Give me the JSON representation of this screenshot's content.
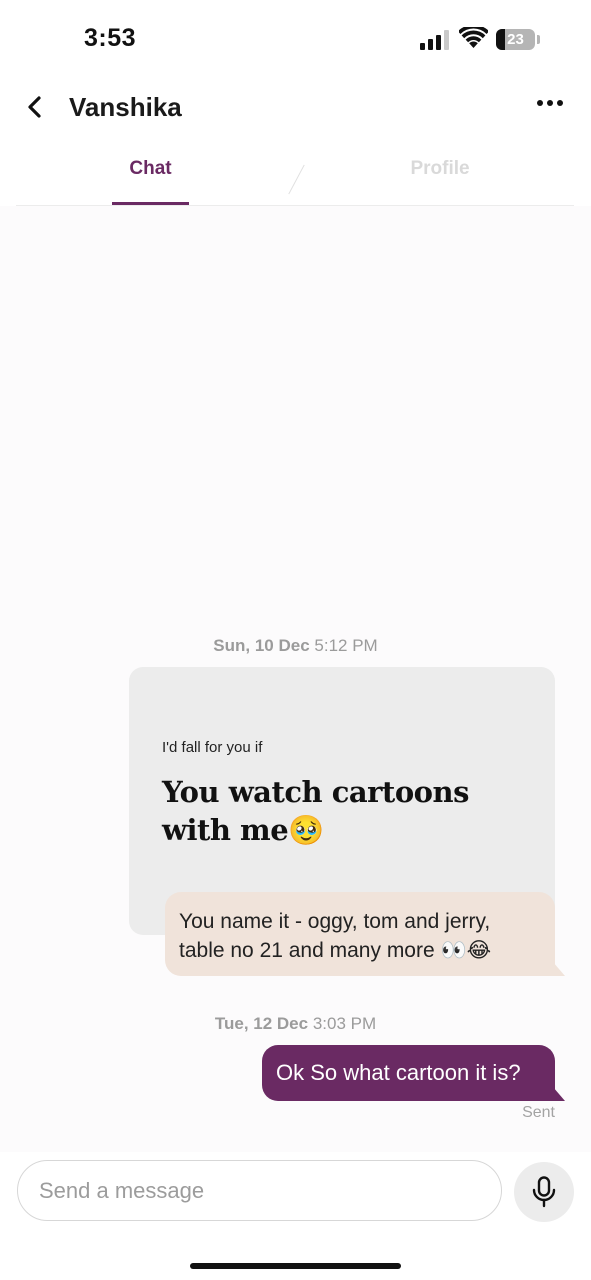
{
  "status_bar": {
    "time": "3:53",
    "battery": "23",
    "icons": [
      "signal-icon",
      "wifi-icon",
      "battery-icon"
    ]
  },
  "header": {
    "contact_name": "Vanshika",
    "tabs": [
      {
        "label": "Chat",
        "active": true
      },
      {
        "label": "Profile",
        "active": false
      }
    ],
    "icons": [
      "back-arrow-icon",
      "more-options-icon"
    ],
    "accent_color": "#6a2a63"
  },
  "messages": {
    "first_timestamp": {
      "day": "Sun, 10 Dec",
      "time": "5:12 PM"
    },
    "prompt_card": {
      "question": "I'd fall for you if",
      "answer": "You watch cartoons with me🥹"
    },
    "reply": {
      "text": "You name it - oggy, tom and jerry, table no 21 and many more 👀😂",
      "bubble_color": "#f0e3da"
    },
    "second_timestamp": {
      "day": "Tue, 12 Dec",
      "time": "3:03 PM"
    },
    "sent_message": {
      "text": "Ok So what cartoon it is?",
      "status": "Sent",
      "bubble_color": "#6a2a63"
    }
  },
  "composer": {
    "placeholder": "Send a message",
    "value": "",
    "icons": [
      "microphone-icon"
    ]
  }
}
